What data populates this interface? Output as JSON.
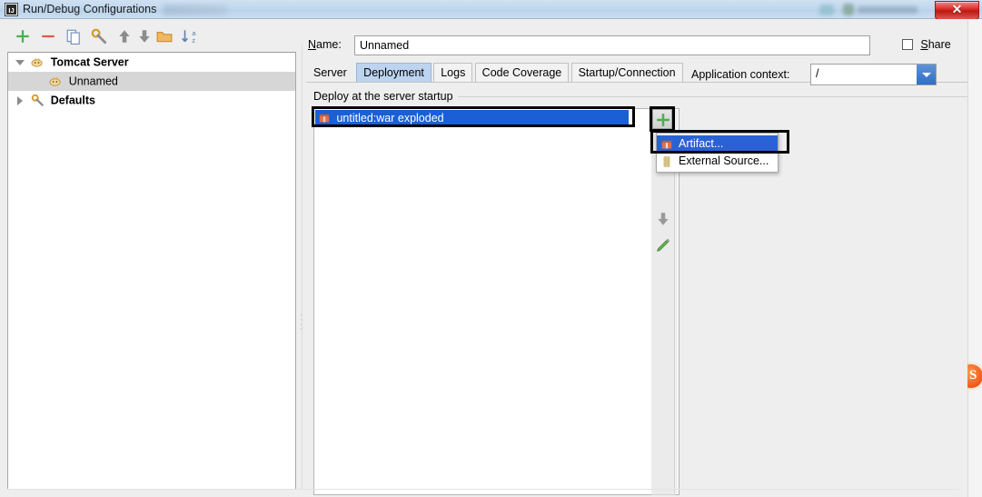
{
  "window": {
    "title": "Run/Debug Configurations",
    "app_icon": "intellij-idea-icon",
    "close_label": "✕"
  },
  "left_panel": {
    "toolbar": [
      {
        "name": "add-configuration-button",
        "icon": "plus-icon",
        "tooltip": "Add New Configuration"
      },
      {
        "name": "remove-configuration-button",
        "icon": "minus-icon",
        "tooltip": "Remove Configuration"
      },
      {
        "name": "copy-configuration-button",
        "icon": "copy-icon",
        "tooltip": "Copy Configuration"
      },
      {
        "name": "edit-templates-button",
        "icon": "wrench-icon",
        "tooltip": "Edit Templates"
      },
      {
        "name": "move-up-button",
        "icon": "arrow-up-icon",
        "tooltip": "Move Up"
      },
      {
        "name": "move-down-button",
        "icon": "arrow-down-icon",
        "tooltip": "Move Down"
      },
      {
        "name": "move-into-folder-button",
        "icon": "folder-icon",
        "tooltip": "Create New Folder"
      },
      {
        "name": "sort-configurations-button",
        "icon": "sort-alpha-icon",
        "tooltip": "Sort Configurations"
      }
    ],
    "tree": [
      {
        "label": "Tomcat Server",
        "icon": "tomcat-icon",
        "expanded": true,
        "bold": true,
        "selected": false,
        "indent": 0
      },
      {
        "label": "Unnamed",
        "icon": "tomcat-icon",
        "expanded": null,
        "bold": false,
        "selected": true,
        "indent": 1
      },
      {
        "label": "Defaults",
        "icon": "wrench-icon",
        "expanded": false,
        "bold": true,
        "selected": false,
        "indent": 0
      }
    ]
  },
  "right_panel": {
    "name_label": "Name:",
    "name_value": "Unnamed",
    "name_placeholder": "",
    "share_label": "Share",
    "share_checked": false,
    "tabs": [
      {
        "label": "Server",
        "active": false
      },
      {
        "label": "Deployment",
        "active": true
      },
      {
        "label": "Logs",
        "active": false
      },
      {
        "label": "Code Coverage",
        "active": false
      },
      {
        "label": "Startup/Connection",
        "active": false
      }
    ],
    "deployment": {
      "section_label": "Deploy at the server startup",
      "items": [
        {
          "label": "untitled:war exploded",
          "icon": "artifact-icon",
          "selected": true
        }
      ],
      "side_toolbar": [
        {
          "name": "add-artifact-button",
          "icon": "plus-icon",
          "highlighted": true
        },
        {
          "name": "move-down-button",
          "icon": "arrow-down-icon",
          "highlighted": false
        },
        {
          "name": "edit-button",
          "icon": "pencil-icon",
          "highlighted": false
        }
      ],
      "popup_menu": [
        {
          "label": "Artifact...",
          "icon": "artifact-icon",
          "selected": true
        },
        {
          "label": "External Source...",
          "icon": "external-source-icon",
          "selected": false
        }
      ],
      "application_context_label": "Application context:",
      "application_context_value": "/"
    }
  },
  "colors": {
    "titlebar_start": "#cfe0f2",
    "titlebar_end": "#cbdef0",
    "selection_blue": "#1a5fd6",
    "popup_selection_blue": "#2a62d6",
    "active_tab_blue": "#bcd4ef",
    "dialog_bg": "#eeeeee",
    "highlight_outline": "#000000",
    "close_button_red": "#d8322b"
  }
}
